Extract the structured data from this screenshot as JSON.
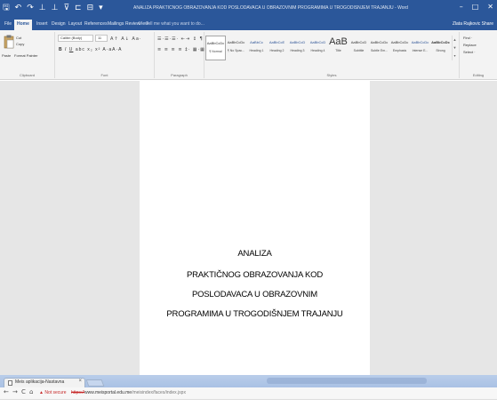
{
  "word": {
    "qat": {
      "save": "🖫",
      "undo": "↶",
      "redo": "↷",
      "a": "⊥",
      "b": "⊥",
      "c": "⊽",
      "d": "⊏",
      "e": "⊟",
      "more": "▾"
    },
    "title": "ANALIZA PRAKTIČNOG OBRAZOVANJA KOD POSLODAVACA U OBRAZOVNIM PROGRAMIMA U TROGODIŠNJEM TRAJANJU - Word",
    "window_controls": {
      "min": "–",
      "max": "□",
      "close": "✕"
    },
    "tabs": [
      "File",
      "Home",
      "Insert",
      "Design",
      "Layout",
      "References",
      "Mailings",
      "Review",
      "View"
    ],
    "active_tab": "Home",
    "tell_me": "Tell me what you want to do...",
    "share": "Zlata Rajkovic  Share",
    "clipboard": {
      "paste": "Paste",
      "cut": "Cut",
      "copy": "Copy",
      "format_painter": "Format Painter",
      "label": "Clipboard"
    },
    "font": {
      "name": "Calibri (Body)",
      "size": "11",
      "bold": "B",
      "italic": "I",
      "underline": "U",
      "rest": "abc x₂ x² A·aA·A",
      "grow": "A↑ A↓ Aa·",
      "label": "Font"
    },
    "paragraph": {
      "row1": "☰·☰·☰· ⇤⇥ ↕ ¶",
      "row2": "≡ ≡ ≡ ≡ ‡· ▦·▦·",
      "label": "Paragraph"
    },
    "styles": {
      "items": [
        {
          "sample": "AaBbCcDc",
          "name": "¶ Normal"
        },
        {
          "sample": "AaBbCcDc",
          "name": "¶ No Spac..."
        },
        {
          "sample": "AaBbCc",
          "name": "Heading 1"
        },
        {
          "sample": "AaBbCcE",
          "name": "Heading 2"
        },
        {
          "sample": "AaBbCcD",
          "name": "Heading 3"
        },
        {
          "sample": "AaBbCcD",
          "name": "Heading 4"
        },
        {
          "sample": "AaB",
          "name": "Title"
        },
        {
          "sample": "AaBbCcD",
          "name": "Subtitle"
        },
        {
          "sample": "AaBbCcDc",
          "name": "Subtle Em..."
        },
        {
          "sample": "AaBbCcDc",
          "name": "Emphasis"
        },
        {
          "sample": "AaBbCcDc",
          "name": "Intense E..."
        },
        {
          "sample": "AaBbCcDc",
          "name": "Strong"
        }
      ],
      "label": "Styles"
    },
    "editing": {
      "find": "Find ·",
      "replace": "Replace",
      "select": "Select ·",
      "label": "Editing"
    },
    "document": {
      "lines": [
        "ANALIZA",
        "PRAKTIČNOG OBRAZOVANJA KOD",
        "POSLODAVACA  U OBRAZOVNIM",
        "PROGRAMIMA U TROGODIŠNJEM TRAJANJU"
      ]
    }
  },
  "browser": {
    "tab_title": "Meis aplikacija-Nastavna",
    "tab_close": "×",
    "back": "←",
    "forward": "→",
    "reload": "C",
    "home": "⌂",
    "security": "▲ Not secure",
    "url_scheme": "https://",
    "url_host": "www.meisportal.edu.me",
    "url_path": "/meisindex/faces/index.jspx"
  }
}
